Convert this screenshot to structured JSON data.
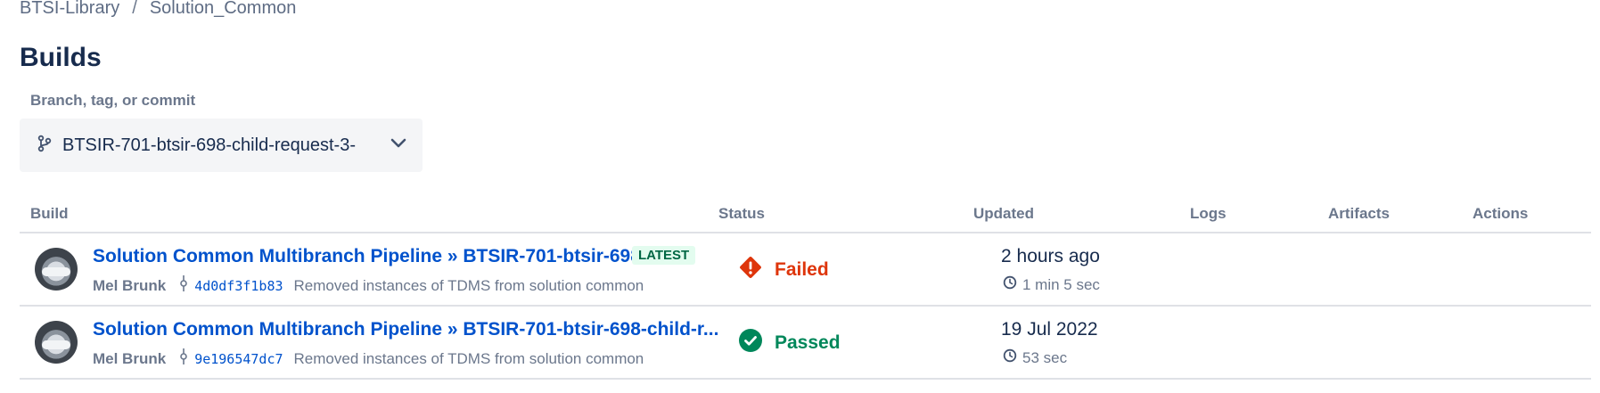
{
  "breadcrumb": {
    "parent": "BTSI-Library",
    "separator": "/",
    "current": "Solution_Common"
  },
  "page": {
    "title": "Builds"
  },
  "filter": {
    "label": "Branch, tag, or commit",
    "value": "BTSIR-701-btsir-698-child-request-3-"
  },
  "table": {
    "headers": {
      "build": "Build",
      "status": "Status",
      "updated": "Updated",
      "logs": "Logs",
      "artifacts": "Artifacts",
      "actions": "Actions"
    },
    "rows": [
      {
        "title": "Solution Common Multibranch Pipeline » BTSIR-701-btsir-698-...",
        "badge": "LATEST",
        "author": "Mel Brunk",
        "commit": "4d0df3f1b83",
        "message": "Removed instances of TDMS from solution common",
        "status": "Failed",
        "updated": "2 hours ago",
        "duration": "1 min 5 sec"
      },
      {
        "title": "Solution Common Multibranch Pipeline » BTSIR-701-btsir-698-child-r...",
        "author": "Mel Brunk",
        "commit": "9e196547dc7",
        "message": "Removed instances of TDMS from solution common",
        "status": "Passed",
        "updated": "19 Jul 2022",
        "duration": "53 sec"
      }
    ]
  },
  "colors": {
    "link": "#0052cc",
    "failed": "#de350b",
    "passed": "#00875a",
    "badge_bg": "#e3fcef",
    "badge_fg": "#006644"
  },
  "icons": {
    "branch": "branch-icon",
    "chevron": "chevron-down-icon",
    "commit": "commit-icon",
    "failed": "failed-diamond-icon",
    "passed": "passed-check-icon",
    "clock": "clock-icon"
  }
}
